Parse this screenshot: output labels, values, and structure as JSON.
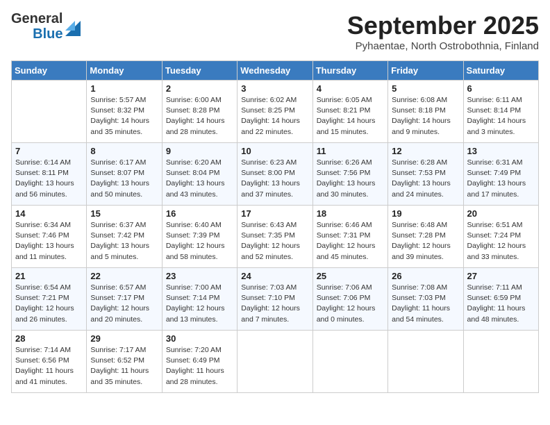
{
  "logo": {
    "general": "General",
    "blue": "Blue"
  },
  "header": {
    "month": "September 2025",
    "location": "Pyhaentae, North Ostrobothnia, Finland"
  },
  "weekdays": [
    "Sunday",
    "Monday",
    "Tuesday",
    "Wednesday",
    "Thursday",
    "Friday",
    "Saturday"
  ],
  "weeks": [
    [
      {
        "day": "",
        "info": ""
      },
      {
        "day": "1",
        "info": "Sunrise: 5:57 AM\nSunset: 8:32 PM\nDaylight: 14 hours\nand 35 minutes."
      },
      {
        "day": "2",
        "info": "Sunrise: 6:00 AM\nSunset: 8:28 PM\nDaylight: 14 hours\nand 28 minutes."
      },
      {
        "day": "3",
        "info": "Sunrise: 6:02 AM\nSunset: 8:25 PM\nDaylight: 14 hours\nand 22 minutes."
      },
      {
        "day": "4",
        "info": "Sunrise: 6:05 AM\nSunset: 8:21 PM\nDaylight: 14 hours\nand 15 minutes."
      },
      {
        "day": "5",
        "info": "Sunrise: 6:08 AM\nSunset: 8:18 PM\nDaylight: 14 hours\nand 9 minutes."
      },
      {
        "day": "6",
        "info": "Sunrise: 6:11 AM\nSunset: 8:14 PM\nDaylight: 14 hours\nand 3 minutes."
      }
    ],
    [
      {
        "day": "7",
        "info": "Sunrise: 6:14 AM\nSunset: 8:11 PM\nDaylight: 13 hours\nand 56 minutes."
      },
      {
        "day": "8",
        "info": "Sunrise: 6:17 AM\nSunset: 8:07 PM\nDaylight: 13 hours\nand 50 minutes."
      },
      {
        "day": "9",
        "info": "Sunrise: 6:20 AM\nSunset: 8:04 PM\nDaylight: 13 hours\nand 43 minutes."
      },
      {
        "day": "10",
        "info": "Sunrise: 6:23 AM\nSunset: 8:00 PM\nDaylight: 13 hours\nand 37 minutes."
      },
      {
        "day": "11",
        "info": "Sunrise: 6:26 AM\nSunset: 7:56 PM\nDaylight: 13 hours\nand 30 minutes."
      },
      {
        "day": "12",
        "info": "Sunrise: 6:28 AM\nSunset: 7:53 PM\nDaylight: 13 hours\nand 24 minutes."
      },
      {
        "day": "13",
        "info": "Sunrise: 6:31 AM\nSunset: 7:49 PM\nDaylight: 13 hours\nand 17 minutes."
      }
    ],
    [
      {
        "day": "14",
        "info": "Sunrise: 6:34 AM\nSunset: 7:46 PM\nDaylight: 13 hours\nand 11 minutes."
      },
      {
        "day": "15",
        "info": "Sunrise: 6:37 AM\nSunset: 7:42 PM\nDaylight: 13 hours\nand 5 minutes."
      },
      {
        "day": "16",
        "info": "Sunrise: 6:40 AM\nSunset: 7:39 PM\nDaylight: 12 hours\nand 58 minutes."
      },
      {
        "day": "17",
        "info": "Sunrise: 6:43 AM\nSunset: 7:35 PM\nDaylight: 12 hours\nand 52 minutes."
      },
      {
        "day": "18",
        "info": "Sunrise: 6:46 AM\nSunset: 7:31 PM\nDaylight: 12 hours\nand 45 minutes."
      },
      {
        "day": "19",
        "info": "Sunrise: 6:48 AM\nSunset: 7:28 PM\nDaylight: 12 hours\nand 39 minutes."
      },
      {
        "day": "20",
        "info": "Sunrise: 6:51 AM\nSunset: 7:24 PM\nDaylight: 12 hours\nand 33 minutes."
      }
    ],
    [
      {
        "day": "21",
        "info": "Sunrise: 6:54 AM\nSunset: 7:21 PM\nDaylight: 12 hours\nand 26 minutes."
      },
      {
        "day": "22",
        "info": "Sunrise: 6:57 AM\nSunset: 7:17 PM\nDaylight: 12 hours\nand 20 minutes."
      },
      {
        "day": "23",
        "info": "Sunrise: 7:00 AM\nSunset: 7:14 PM\nDaylight: 12 hours\nand 13 minutes."
      },
      {
        "day": "24",
        "info": "Sunrise: 7:03 AM\nSunset: 7:10 PM\nDaylight: 12 hours\nand 7 minutes."
      },
      {
        "day": "25",
        "info": "Sunrise: 7:06 AM\nSunset: 7:06 PM\nDaylight: 12 hours\nand 0 minutes."
      },
      {
        "day": "26",
        "info": "Sunrise: 7:08 AM\nSunset: 7:03 PM\nDaylight: 11 hours\nand 54 minutes."
      },
      {
        "day": "27",
        "info": "Sunrise: 7:11 AM\nSunset: 6:59 PM\nDaylight: 11 hours\nand 48 minutes."
      }
    ],
    [
      {
        "day": "28",
        "info": "Sunrise: 7:14 AM\nSunset: 6:56 PM\nDaylight: 11 hours\nand 41 minutes."
      },
      {
        "day": "29",
        "info": "Sunrise: 7:17 AM\nSunset: 6:52 PM\nDaylight: 11 hours\nand 35 minutes."
      },
      {
        "day": "30",
        "info": "Sunrise: 7:20 AM\nSunset: 6:49 PM\nDaylight: 11 hours\nand 28 minutes."
      },
      {
        "day": "",
        "info": ""
      },
      {
        "day": "",
        "info": ""
      },
      {
        "day": "",
        "info": ""
      },
      {
        "day": "",
        "info": ""
      }
    ]
  ]
}
